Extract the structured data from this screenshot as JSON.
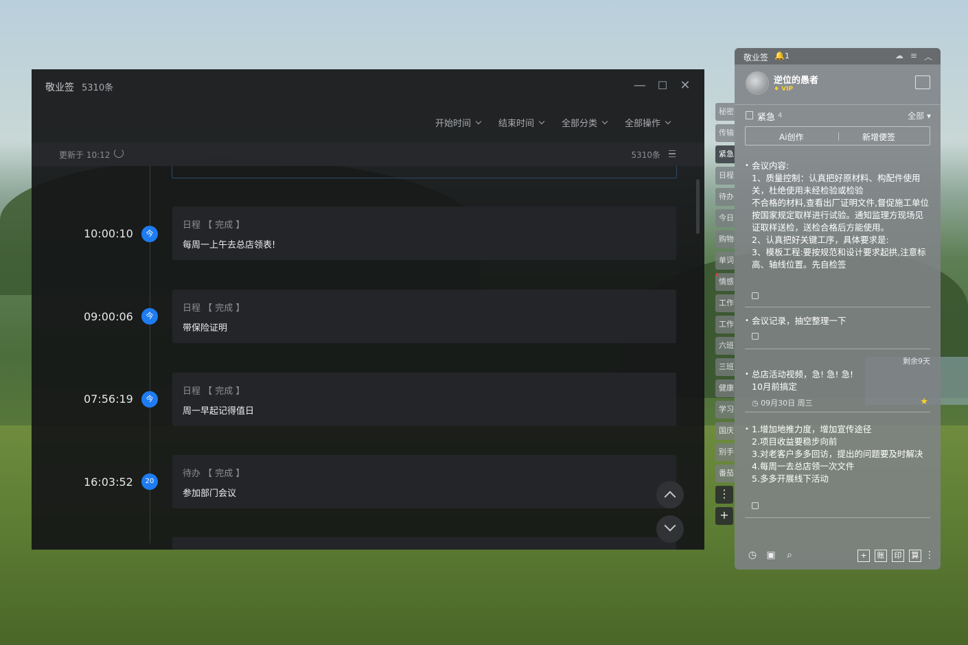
{
  "main_window": {
    "title": "敬业签",
    "count": "5310条",
    "controls": {
      "minimize": "—",
      "maximize": "☐",
      "close": "✕"
    },
    "filters": [
      "开始时间",
      "结束时间",
      "全部分类",
      "全部操作"
    ],
    "update_text": "更新于 10:12",
    "list_count": "5310条",
    "entries": [
      {
        "time": "10:00:10",
        "badge": "今",
        "meta": "日程 【 完成 】",
        "title": "每周一上午去总店领表!"
      },
      {
        "time": "09:00:06",
        "badge": "今",
        "meta": "日程 【 完成 】",
        "title": "带保险证明"
      },
      {
        "time": "07:56:19",
        "badge": "今",
        "meta": "日程 【 完成 】",
        "title": "周一早起记得值日"
      },
      {
        "time": "16:03:52",
        "badge": "20",
        "meta": "待办 【 完成 】",
        "title": "参加部门会议"
      }
    ]
  },
  "side_tabs": [
    "秘密",
    "传输",
    "紧急",
    "日程",
    "待办",
    "今日",
    "购物",
    "单词",
    "情感",
    "工作",
    "工作",
    "六班",
    "三班",
    "健康",
    "学习",
    "国庆",
    "别手",
    "番茄"
  ],
  "side_buttons": {
    "more": "⋮",
    "add": "+"
  },
  "sticky": {
    "title": "敬业签",
    "notify_count": "1",
    "user": {
      "name": "逆位的愚者",
      "vip": "VIP"
    },
    "category": {
      "name": "紧急",
      "count": "4",
      "filter": "全部"
    },
    "buttons": {
      "ai": "Ai创作",
      "new": "新增便签"
    },
    "notes": [
      {
        "text": "会议内容:\n1、质量控制：认真把好原材料、构配件使用关，杜绝使用未经检验或检验\n不合格的材料,查看出厂证明文件,督促施工单位按国家规定取样进行试验。通知监理方现场见证取样送检，送检合格后方能使用。\n2、认真把好关键工序，具体要求是:\n3、模板工程:要按规范和设计要求起拱,注意标高、轴线位置。先自检签"
      },
      {
        "text": "会议记录，抽空整理一下"
      },
      {
        "text": "总店活动视频，急! 急! 急!\n10月前搞定",
        "remain": "剩余9天",
        "date": "09月30日 周三"
      },
      {
        "text": "1.增加地推力度，增加宣传途径\n2.项目收益要稳步向前\n3.对老客户多多回访，提出的问题要及时解决\n4.每周一去总店领一次文件\n5.多多开展线下活动"
      }
    ],
    "footer_tools": [
      "账",
      "印",
      "算"
    ],
    "colors": {
      "accent": "#1e7bf0",
      "star": "#ffd21f",
      "vip": "#ffcf2e"
    }
  }
}
